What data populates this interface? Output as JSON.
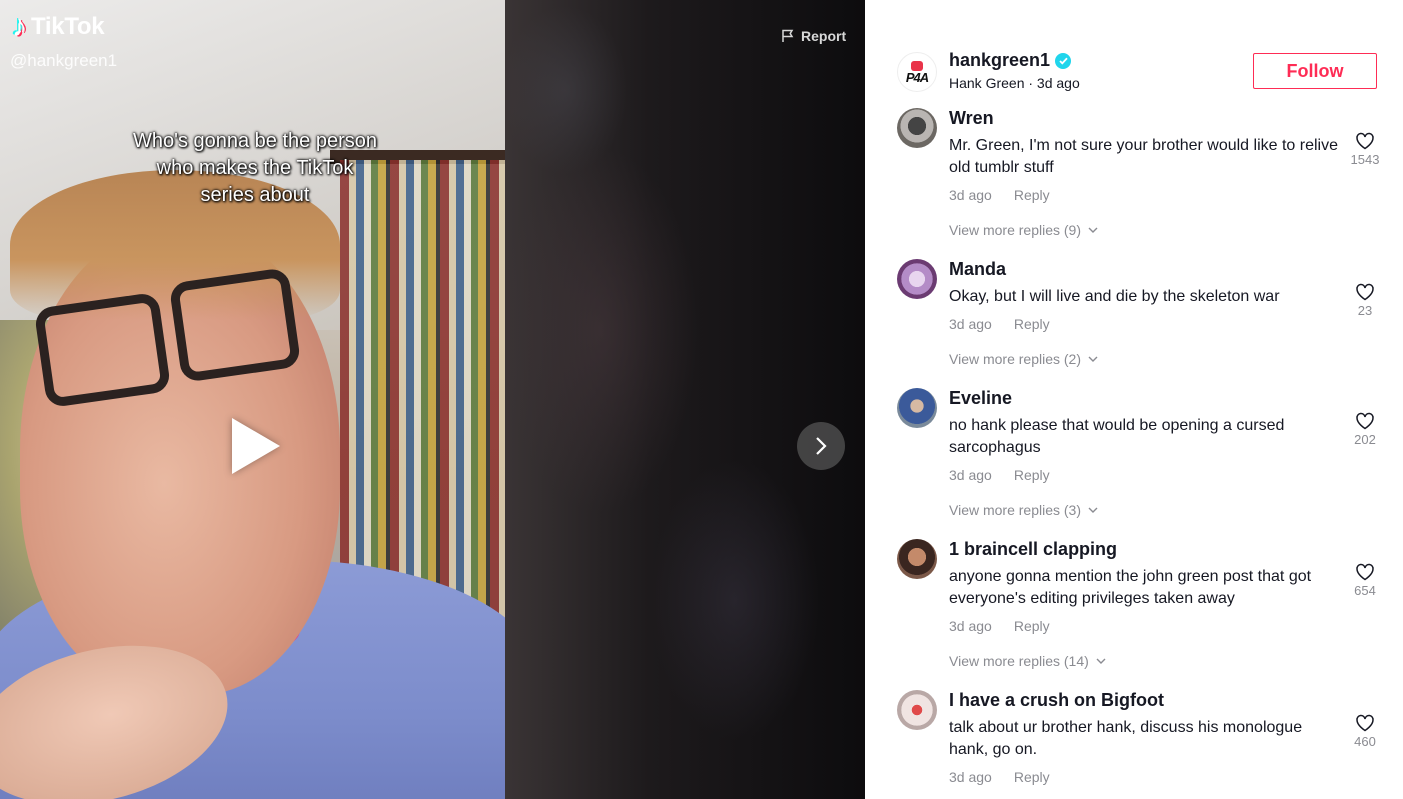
{
  "brand": {
    "logo_text": "TikTok",
    "handle": "@hankgreen1"
  },
  "video": {
    "caption_lines": [
      "Who's gonna be the person",
      "who makes the TikTok",
      "series about"
    ],
    "report_label": "Report"
  },
  "author": {
    "avatar_text": "P4A",
    "username": "hankgreen1",
    "subtitle": "Hank Green · 3d ago",
    "follow_label": "Follow"
  },
  "comments": [
    {
      "name": "Wren",
      "text": "Mr. Green, I'm not sure your brother would like to relive old tumblr stuff",
      "time": "3d ago",
      "reply": "Reply",
      "likes": "1543",
      "more": "View more replies (9)"
    },
    {
      "name": "Manda",
      "text": "Okay, but I will live and die by the skeleton war",
      "time": "3d ago",
      "reply": "Reply",
      "likes": "23",
      "more": "View more replies (2)"
    },
    {
      "name": "Eveline",
      "text": "no hank please that would be opening a cursed sarcophagus",
      "time": "3d ago",
      "reply": "Reply",
      "likes": "202",
      "more": "View more replies (3)"
    },
    {
      "name": "1 braincell clapping",
      "text": "anyone gonna mention the john green post that got everyone's editing privileges taken away",
      "time": "3d ago",
      "reply": "Reply",
      "likes": "654",
      "more": "View more replies (14)"
    },
    {
      "name": "I have a crush on Bigfoot",
      "text": "talk about ur brother hank, discuss his monologue hank, go on.",
      "time": "3d ago",
      "reply": "Reply",
      "likes": "460",
      "more": ""
    }
  ],
  "colors": {
    "accent": "#fe2c55",
    "verified": "#20d5ec",
    "muted": "#8a8b91"
  },
  "icons": {
    "report": "flag-icon",
    "next": "chevron-right-icon",
    "like": "heart-icon",
    "expand": "chevron-down-icon",
    "play": "play-icon",
    "verified": "verified-badge-icon"
  }
}
